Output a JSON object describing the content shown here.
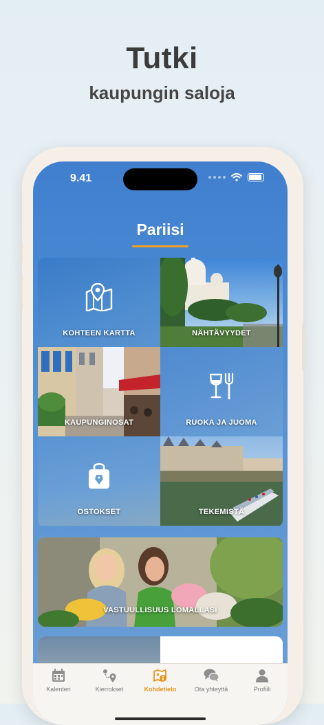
{
  "promo": {
    "title": "Tutki",
    "subtitle": "kaupungin saloja"
  },
  "status_bar": {
    "time": "9.41"
  },
  "header": {
    "city": "Pariisi"
  },
  "tiles": [
    {
      "label": "KOHTEEN KARTTA",
      "icon": "map-pin-icon"
    },
    {
      "label": "NÄHTÄVYYDET",
      "icon": ""
    },
    {
      "label": "KAUPUNGINOSAT",
      "icon": ""
    },
    {
      "label": "RUOKA JA JUOMA",
      "icon": "wine-fork-icon"
    },
    {
      "label": "OSTOKSET",
      "icon": "shopping-bag-icon"
    },
    {
      "label": "TEKEMISTÄ",
      "icon": ""
    }
  ],
  "wide_tile": {
    "label": "VASTUULLISUUS LOMALLASI"
  },
  "tabbar": {
    "active_index": 2,
    "items": [
      {
        "label": "Kalenteri",
        "icon": "calendar-icon"
      },
      {
        "label": "Kierrokset",
        "icon": "route-icon"
      },
      {
        "label": "Kohdetieto",
        "icon": "destination-info-icon"
      },
      {
        "label": "Ota yhteyttä",
        "icon": "chat-icon"
      },
      {
        "label": "Profiili",
        "icon": "profile-icon"
      }
    ]
  },
  "colors": {
    "accent": "#f2a022",
    "screen_blue": "#4a8ad3",
    "tab_active": "#e8951e"
  }
}
